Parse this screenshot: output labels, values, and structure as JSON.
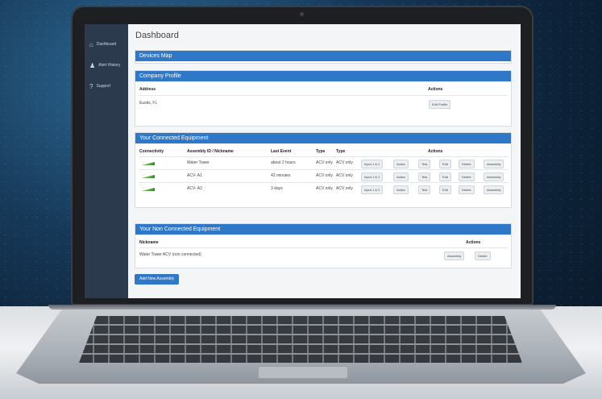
{
  "sidebar": {
    "items": [
      {
        "label": "Dashboard",
        "icon": "home-icon"
      },
      {
        "label": "Alert History",
        "icon": "bell-icon"
      },
      {
        "label": "Support",
        "icon": "help-icon"
      }
    ]
  },
  "page": {
    "title": "Dashboard"
  },
  "panels": {
    "devices_map": "Devices Map",
    "company_profile": {
      "title": "Company Profile",
      "address_header": "Address",
      "actions_header": "Actions",
      "address": "Eustis, FL",
      "edit_button": "Edit Profile"
    },
    "connected": {
      "title": "Your Connected Equipment",
      "headers": [
        "Connectivity",
        "Assembly ID / Nickname",
        "Last Event",
        "Type",
        "Type",
        "Actions"
      ],
      "rows": [
        {
          "name": "Water Tower",
          "last_event": "about 2 hours",
          "type1": "ACV only",
          "type2": "ACV only"
        },
        {
          "name": "ACV- A1",
          "last_event": "42 minutes",
          "type1": "ACV only",
          "type2": "ACV only"
        },
        {
          "name": "ACV- A2",
          "last_event": "3 days",
          "type1": "ACV only",
          "type2": "ACV only"
        }
      ],
      "row_buttons": [
        "Input 1 & 2",
        "Active",
        "Test",
        "Edit",
        "Delete",
        "Assembly"
      ]
    },
    "non_connected": {
      "title": "Your Non Connected Equipment",
      "nickname_header": "Nickname",
      "actions_header": "Actions",
      "row": "Water Tower ACV (non connected)",
      "assembly_button": "Assembly",
      "delete_button": "Delete"
    },
    "add_button": "Add New Assembly"
  },
  "colors": {
    "accent": "#2f78c7",
    "sidebar": "#2b3a4c",
    "signal": "#2c8f2c"
  }
}
